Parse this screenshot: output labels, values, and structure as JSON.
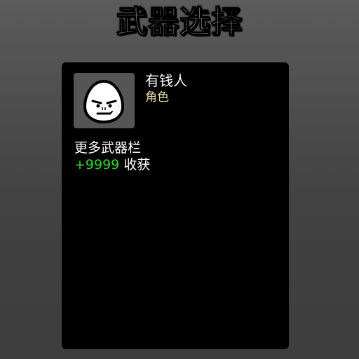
{
  "header": {
    "title": "武器选择"
  },
  "character": {
    "name": "有钱人",
    "type": "角色",
    "portrait_icon": "egg-face-icon"
  },
  "effects": {
    "line1": "更多武器栏",
    "bonus_value": "+9999",
    "bonus_label": "收获"
  },
  "colors": {
    "panel_bg": "#000000",
    "type_color": "#e8d8a0",
    "bonus_color": "#2bdc2b",
    "portrait_bg": "#555555"
  }
}
